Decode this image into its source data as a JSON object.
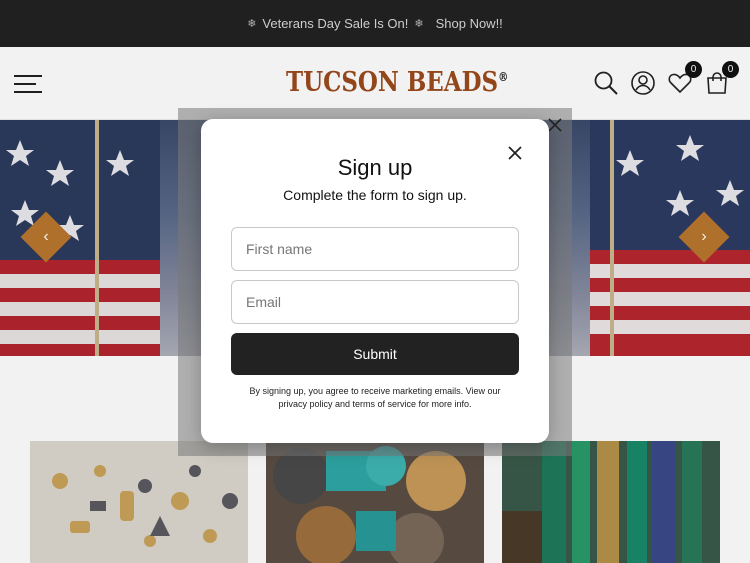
{
  "announcement": {
    "text": "Veterans Day Sale Is On!",
    "link": "Shop Now!!"
  },
  "header": {
    "logo": "TUCSON BEADS",
    "logo_mark": "®",
    "wishlist_count": "0",
    "cart_count": "0"
  },
  "hero": {
    "prev_glyph": "‹",
    "next_glyph": "›"
  },
  "popup": {
    "title": "Sign up",
    "subtitle": "Complete the form to sign up.",
    "first_name_placeholder": "First name",
    "email_placeholder": "Email",
    "submit_label": "Submit",
    "legal": "By signing up, you agree to receive marketing emails. View our privacy policy and terms of service for more info."
  },
  "colors": {
    "accent": "#b9762e",
    "logo": "#9a4a1c",
    "dark": "#222222"
  }
}
